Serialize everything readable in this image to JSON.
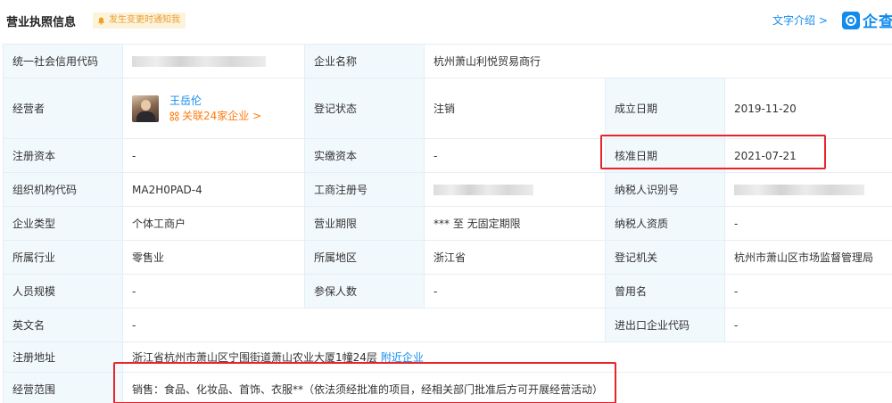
{
  "header": {
    "title": "营业执照信息",
    "notify_label": "发生变更时通知我",
    "intro_link": "文字介绍 >",
    "logo_text": "企查"
  },
  "rows": {
    "credit_code": {
      "label": "统一社会信用代码",
      "value": ""
    },
    "company_name": {
      "label": "企业名称",
      "value": "杭州萧山利悦贸易商行"
    },
    "operator": {
      "label": "经营者",
      "name": "王岳伦",
      "related": "关联24家企业 >"
    },
    "reg_status": {
      "label": "登记状态",
      "value": "注销"
    },
    "found_date": {
      "label": "成立日期",
      "value": "2019-11-20"
    },
    "reg_capital": {
      "label": "注册资本",
      "value": "-"
    },
    "paid_capital": {
      "label": "实缴资本",
      "value": "-"
    },
    "approve_date": {
      "label": "核准日期",
      "value": "2021-07-21"
    },
    "org_code": {
      "label": "组织机构代码",
      "value": "MA2H0PAD-4"
    },
    "biz_reg_no": {
      "label": "工商注册号",
      "value": ""
    },
    "taxpayer_id": {
      "label": "纳税人识别号",
      "value": ""
    },
    "company_type": {
      "label": "企业类型",
      "value": "个体工商户"
    },
    "biz_term": {
      "label": "营业期限",
      "value": "*** 至 无固定期限"
    },
    "taxpayer_qual": {
      "label": "纳税人资质",
      "value": "-"
    },
    "industry": {
      "label": "所属行业",
      "value": "零售业"
    },
    "region": {
      "label": "所属地区",
      "value": "浙江省"
    },
    "reg_authority": {
      "label": "登记机关",
      "value": "杭州市萧山区市场监督管理局"
    },
    "staff_size": {
      "label": "人员规模",
      "value": "-"
    },
    "insured": {
      "label": "参保人数",
      "value": "-"
    },
    "former_name": {
      "label": "曾用名",
      "value": "-"
    },
    "english_name": {
      "label": "英文名",
      "value": "-"
    },
    "import_export": {
      "label": "进出口企业代码",
      "value": "-"
    },
    "address": {
      "label": "注册地址",
      "value": "浙江省杭州市萧山区宁围街道萧山农业大厦1幢24层",
      "nearby": "附近企业"
    },
    "scope": {
      "label": "经营范围",
      "value": "销售：食品、化妆品、首饰、衣服**（依法须经批准的项目，经相关部门批准后方可开展经营活动）"
    }
  },
  "colors": {
    "accent_blue": "#128bed",
    "label_bg": "#f2f9fc",
    "border": "#e4eef6",
    "notify_bg": "#fdf3dc",
    "notify_text": "#e8a030",
    "related_orange": "#fd7c12",
    "highlight_red": "#e8232a"
  },
  "icons": {
    "notify": "bell-icon",
    "related": "link-icon",
    "logo": "qcc-logo-icon"
  }
}
